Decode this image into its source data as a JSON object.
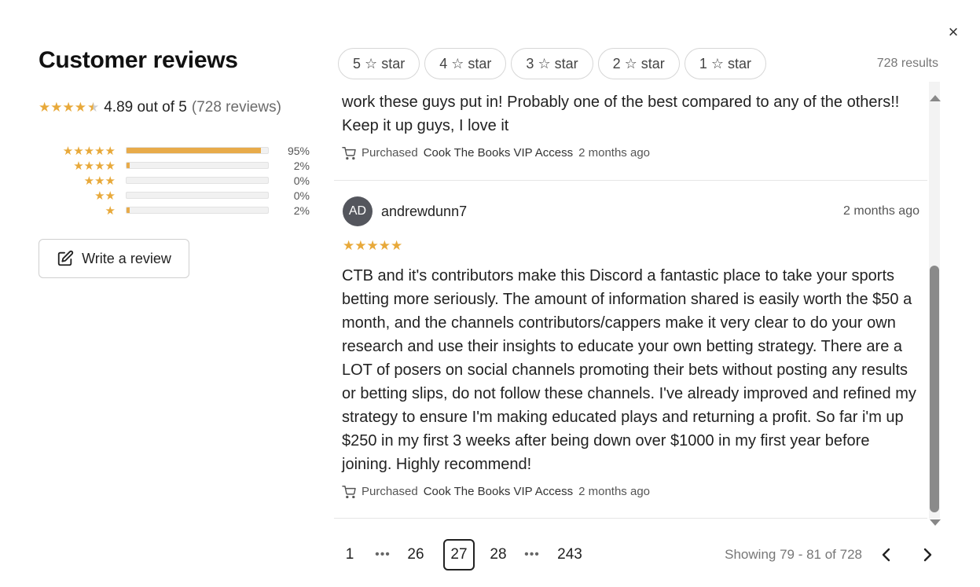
{
  "close_label": "×",
  "header": {
    "title": "Customer reviews"
  },
  "summary": {
    "rating": 4.89,
    "rating_text": "4.89 out of 5",
    "reviews_text": "(728 reviews)",
    "distribution": [
      {
        "stars": 5,
        "percent": 95,
        "label": "95%"
      },
      {
        "stars": 4,
        "percent": 2,
        "label": "2%"
      },
      {
        "stars": 3,
        "percent": 0,
        "label": "0%"
      },
      {
        "stars": 2,
        "percent": 0,
        "label": "0%"
      },
      {
        "stars": 1,
        "percent": 2,
        "label": "2%"
      }
    ]
  },
  "write_review": {
    "label": "Write a review",
    "icon": "edit-icon"
  },
  "filters": [
    "5",
    "4",
    "3",
    "2",
    "1"
  ],
  "filter_suffix": "star",
  "results_text": "728 results",
  "reviews": [
    {
      "text": "work these guys put in! Probably one of the best compared to any of the others!! Keep it up guys, I love it",
      "purchase_prefix": "Purchased",
      "product": "Cook The Books VIP Access",
      "purchase_date": "2 months ago"
    },
    {
      "initials": "AD",
      "username": "andrewdunn7",
      "date": "2 months ago",
      "rating": 5,
      "text": "CTB and it's contributors make this Discord a fantastic place to take your sports betting more seriously. The amount of information shared is easily worth the $50 a month, and the channels contributors/cappers make it very clear to do your own research and use their insights to educate your own betting strategy. There are a LOT of posers on social channels promoting their bets without posting any results or betting slips, do not follow these channels. I've already improved and refined my strategy to ensure I'm making educated plays and returning a profit. So far i'm up $250 in my first 3 weeks after being down over $1000 in my first year before joining. Highly recommend!",
      "purchase_prefix": "Purchased",
      "product": "Cook The Books VIP Access",
      "purchase_date": "2 months ago"
    }
  ],
  "pagination": {
    "pages": [
      "1",
      "•••",
      "26",
      "27",
      "28",
      "•••",
      "243"
    ],
    "current": "27",
    "showing": "Showing 79 - 81 of 728"
  },
  "colors": {
    "star": "#e8a93a",
    "bar_fill": "#e8ab4a",
    "avatar": "#54565d"
  }
}
